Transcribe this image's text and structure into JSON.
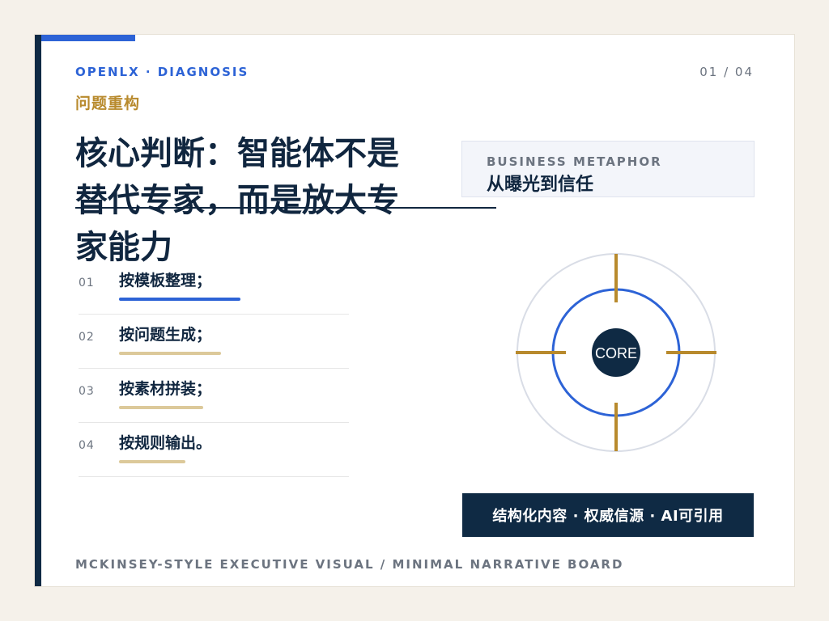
{
  "header": {
    "kicker": "OPENLX · DIAGNOSIS",
    "section": "问题重构",
    "pager": "01 / 04"
  },
  "headline": "核心判断：智能体不是替代专家，而是放大专家能力",
  "steps": [
    {
      "num": "01",
      "text": "按模板整理；",
      "state": "active"
    },
    {
      "num": "02",
      "text": "按问题生成；"
    },
    {
      "num": "03",
      "text": "按素材拼装；"
    },
    {
      "num": "04",
      "text": "按规则输出。"
    }
  ],
  "metaphor": {
    "eyebrow": "BUSINESS METAPHOR",
    "title": "从曝光到信任"
  },
  "diagram": {
    "core_label": "CORE",
    "colors": {
      "outer_ring": "#d9dde6",
      "inner_ring": "#2d63d6",
      "ticks": "#b88a2d",
      "core": "#0f2a44"
    }
  },
  "callout": "结构化内容 · 权威信源 · AI可引用",
  "footer": "MCKINSEY-STYLE EXECUTIVE VISUAL / MINIMAL NARRATIVE BOARD",
  "colors": {
    "navy": "#0f2a44",
    "blue": "#2d63d6",
    "gold": "#b88a2d",
    "muted": "#6c7480"
  }
}
